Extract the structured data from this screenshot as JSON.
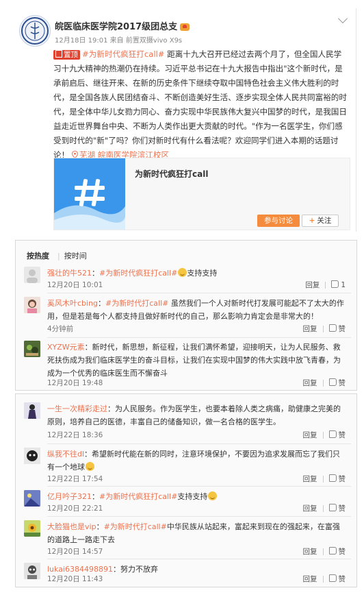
{
  "post": {
    "author": "皖医临床医学院2017级团总支",
    "meta": "12月18日 19:01 来自 前置双摄vivo X9s",
    "badge": "置顶",
    "topic_link": "#为新时代疯狂打call#",
    "text": " 距离十九大召开已经过去两个月了，但全国人民学习十九大精神的热潮仍在持续。习近平总书记在十九大报告中指出\"这个新时代，是承前启后、继往开来、在新的历史条件下继续夺取中国特色社会主义伟大胜利的时代，是全国各族人民团结奋斗、不断创造美好生活、逐步实现全体人民共同富裕的时代，是全体中华儿女勠力同心、奋力实现中华民族伟大复兴中国梦的时代，是我国日益走近世界舞台中央、不断为人类作出更大贡献的时代。\"作为一名医学生，你们感受到时代的\"新\"了吗？你们对新时代有什么看法呢？欢迎同学们进入本期的话题讨论！ ",
    "location": "芜湖 皖南医学院滨江校区",
    "topic_card": {
      "title": "为新时代疯狂打call",
      "join_label": "参与讨论",
      "follow_label": "关注"
    }
  },
  "sort_tabs": {
    "hot": "按热度",
    "time": "按时间"
  },
  "actions": {
    "reply": "回复",
    "like": "赞"
  },
  "comments_top": [
    {
      "user": "强壮的牛521",
      "body": "支持支持",
      "topic": "#为新时代疯狂打call#",
      "emoji": true,
      "time": "12月20日 10:01",
      "likes": "1"
    },
    {
      "user": "奚风木叶cbing",
      "body": "虽然我们一个人对新时代打发展可能起不了太大的作用，但是若是每个人都支持且做好新时代的自己，那么影响力肯定会是非常大的！",
      "topic": "#为新时代打call#",
      "emoji": false,
      "time": "4分钟前",
      "likes": "赞"
    },
    {
      "user": "XYZW元素",
      "body": "新时代，新思想，新征程，让我们满怀希望，迎接明天，让为人民服务、救死扶伤成为我们临床医学生的奋斗目标，让我们在实现中国梦的伟大实践中放飞青春，为成为一个优秀的临床医生而不懈奋斗",
      "topic": "",
      "emoji": false,
      "time": "12月20日 19:48",
      "likes": "赞"
    }
  ],
  "comments_bottom": [
    {
      "user": "一生一次精彩走过",
      "body": "为人民服务。作为医学生，也要本着除人类之病痛，助健康之完美的原则，培养自己的医德，丰富自己的储备知识，做一名合格的医学生。",
      "topic": "",
      "emoji": false,
      "time": "12月22日 18:36",
      "likes": "赞"
    },
    {
      "user": "纵我不往dl",
      "body": "希望新时代能在新的同时，注意环境保护，不要因为追求发展而忘了我们只有一个地球",
      "topic": "",
      "emoji": true,
      "time": "12月22日 17:54",
      "likes": "赞"
    },
    {
      "user": "亿月吟子321",
      "body": "支持支持",
      "topic": "#为新时代疯狂打call#",
      "emoji": true,
      "time": "12月20日 22:21",
      "likes": "赞"
    },
    {
      "user": "大脸猫也是vip",
      "body": "中华民族从站起来，富起来到现在的强起来，在富强的道路上一路走下去",
      "topic": "#为新时代打call#",
      "emoji": false,
      "time": "12月20日 14:57",
      "likes": "赞"
    },
    {
      "user": "lukai6384498891",
      "body": "努力不放弃",
      "topic": "",
      "emoji": false,
      "time": "12月20日 11:43",
      "likes": "赞"
    }
  ]
}
